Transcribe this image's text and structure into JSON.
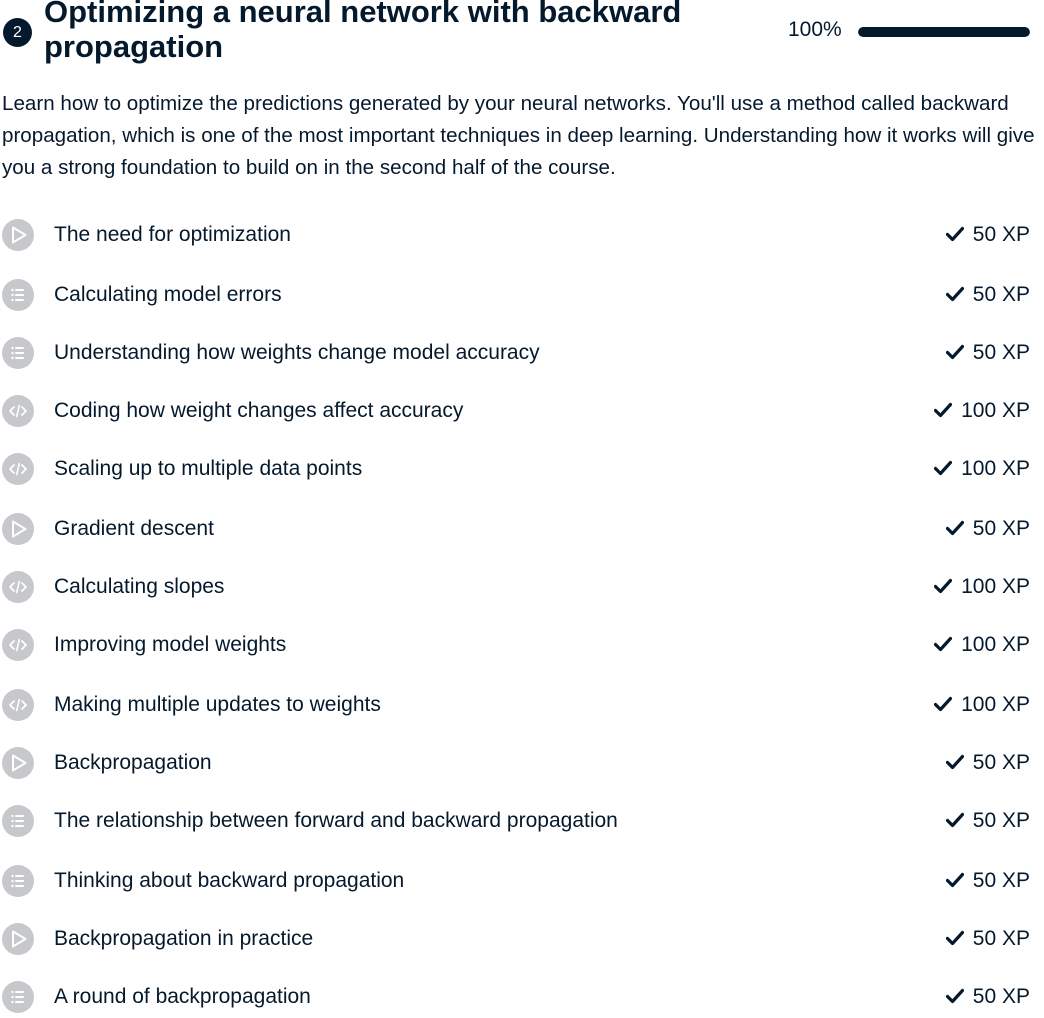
{
  "chapter": {
    "number": "2",
    "title": "Optimizing a neural network with backward propagation",
    "progress_label": "100%",
    "progress_fraction": 1.0,
    "description": "Learn how to optimize the predictions generated by your neural networks. You'll use a method called backward propagation, which is one of the most important techniques in deep learning. Understanding how it works will give you a strong foundation to build on in the second half of the course."
  },
  "colors": {
    "text": "#05192d",
    "icon_bg": "#c7c8cb",
    "progress": "#05192d"
  },
  "exercises": [
    {
      "title": "The need for optimization",
      "xp": "50 XP",
      "icon": "video-icon"
    },
    {
      "title": "Calculating model errors",
      "xp": "50 XP",
      "icon": "multiple-choice-icon"
    },
    {
      "title": "Understanding how weights change model accuracy",
      "xp": "50 XP",
      "icon": "multiple-choice-icon"
    },
    {
      "title": "Coding how weight changes affect accuracy",
      "xp": "100 XP",
      "icon": "code-icon"
    },
    {
      "title": "Scaling up to multiple data points",
      "xp": "100 XP",
      "icon": "code-icon"
    },
    {
      "title": "Gradient descent",
      "xp": "50 XP",
      "icon": "video-icon"
    },
    {
      "title": "Calculating slopes",
      "xp": "100 XP",
      "icon": "code-icon"
    },
    {
      "title": "Improving model weights",
      "xp": "100 XP",
      "icon": "code-icon"
    },
    {
      "title": "Making multiple updates to weights",
      "xp": "100 XP",
      "icon": "code-icon"
    },
    {
      "title": "Backpropagation",
      "xp": "50 XP",
      "icon": "video-icon"
    },
    {
      "title": "The relationship between forward and backward propagation",
      "xp": "50 XP",
      "icon": "multiple-choice-icon"
    },
    {
      "title": "Thinking about backward propagation",
      "xp": "50 XP",
      "icon": "multiple-choice-icon"
    },
    {
      "title": "Backpropagation in practice",
      "xp": "50 XP",
      "icon": "video-icon"
    },
    {
      "title": "A round of backpropagation",
      "xp": "50 XP",
      "icon": "multiple-choice-icon"
    }
  ]
}
